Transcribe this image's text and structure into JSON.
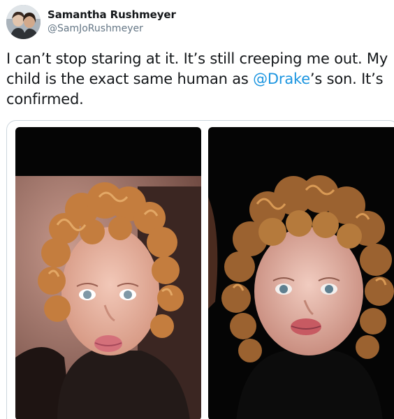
{
  "tweet": {
    "display_name": "Samantha Rushmeyer",
    "handle": "@SamJoRushmeyer",
    "text_before": "I can’t stop staring at it. It’s still creeping me out. My child is the exact same human as ",
    "mention": "@Drake",
    "text_after": "’s son. It’s confirmed.",
    "avatar_icon": "profile-avatar",
    "media": [
      {
        "icon": "child-photo-left"
      },
      {
        "icon": "child-photo-right"
      }
    ]
  },
  "colors": {
    "text": "#14171a",
    "secondary": "#657786",
    "mention": "#1b95e0",
    "media_border": "#ccd6dd"
  }
}
